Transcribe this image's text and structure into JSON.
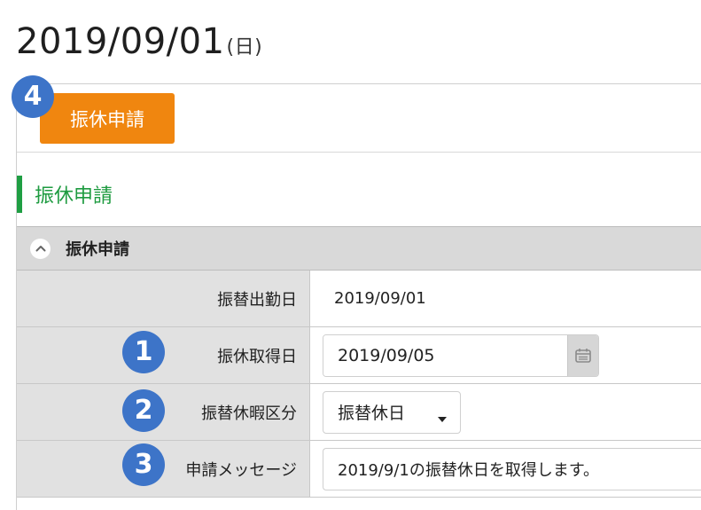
{
  "header": {
    "date": "2019/09/01",
    "weekday": "(日)"
  },
  "actions": {
    "apply_button": "振休申請"
  },
  "section": {
    "title": "振休申請"
  },
  "panel": {
    "title": "振休申請",
    "toggle_icon": "chevron-up-icon"
  },
  "form": {
    "work_date": {
      "label": "振替出勤日",
      "value": "2019/09/01"
    },
    "leave_date": {
      "label": "振休取得日",
      "value": "2019/09/05",
      "icon": "calendar-icon"
    },
    "leave_type": {
      "label": "振替休暇区分",
      "selected": "振替休日",
      "icon": "dropdown-caret-icon"
    },
    "message": {
      "label": "申請メッセージ",
      "value": "2019/9/1の振替休日を取得します。"
    }
  },
  "steps": {
    "leave_date": "1",
    "leave_type": "2",
    "message": "3",
    "apply": "4"
  },
  "colors": {
    "primary_button": "#f0860f",
    "section_accent": "#1f9e43",
    "step_badge": "#3d74c8"
  }
}
